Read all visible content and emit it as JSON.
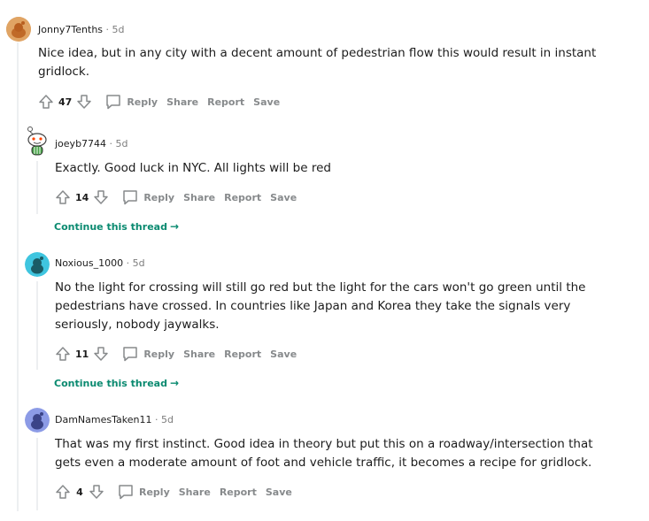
{
  "comments": [
    {
      "username": "Jonny7Tenths",
      "time": "5d",
      "text": "Nice idea, but in any city with a decent amount of pedestrian flow this would result in instant gridlock.",
      "score": "47",
      "avatar_color": "#d99a57"
    },
    {
      "username": "joeyb7744",
      "time": "5d",
      "text": "Exactly. Good luck in NYC. All lights will be red",
      "score": "14",
      "avatar_color": "#ffffff"
    },
    {
      "username": "Noxious_1000",
      "time": "5d",
      "text": "No the light for crossing will still go red but the light for the cars won't go green until the pedestrians have crossed. In countries like Japan and Korea they take the signals very seriously, nobody jaywalks.",
      "score": "11",
      "avatar_color": "#3fc5df"
    },
    {
      "username": "DamNamesTaken11",
      "time": "5d",
      "text": "That was my first instinct. Good idea in theory but put this on a roadway/intersection that gets even a moderate amount of foot and vehicle traffic, it becomes a recipe for gridlock.",
      "score": "4",
      "avatar_color": "#8c9be6"
    }
  ],
  "actions": {
    "reply": "Reply",
    "share": "Share",
    "report": "Report",
    "save": "Save"
  },
  "continue_thread": "Continue this thread",
  "separator": "·",
  "colors": {
    "link_green": "#0a8a70",
    "action_gray": "#878a8c",
    "thread_line": "#edeff1"
  }
}
